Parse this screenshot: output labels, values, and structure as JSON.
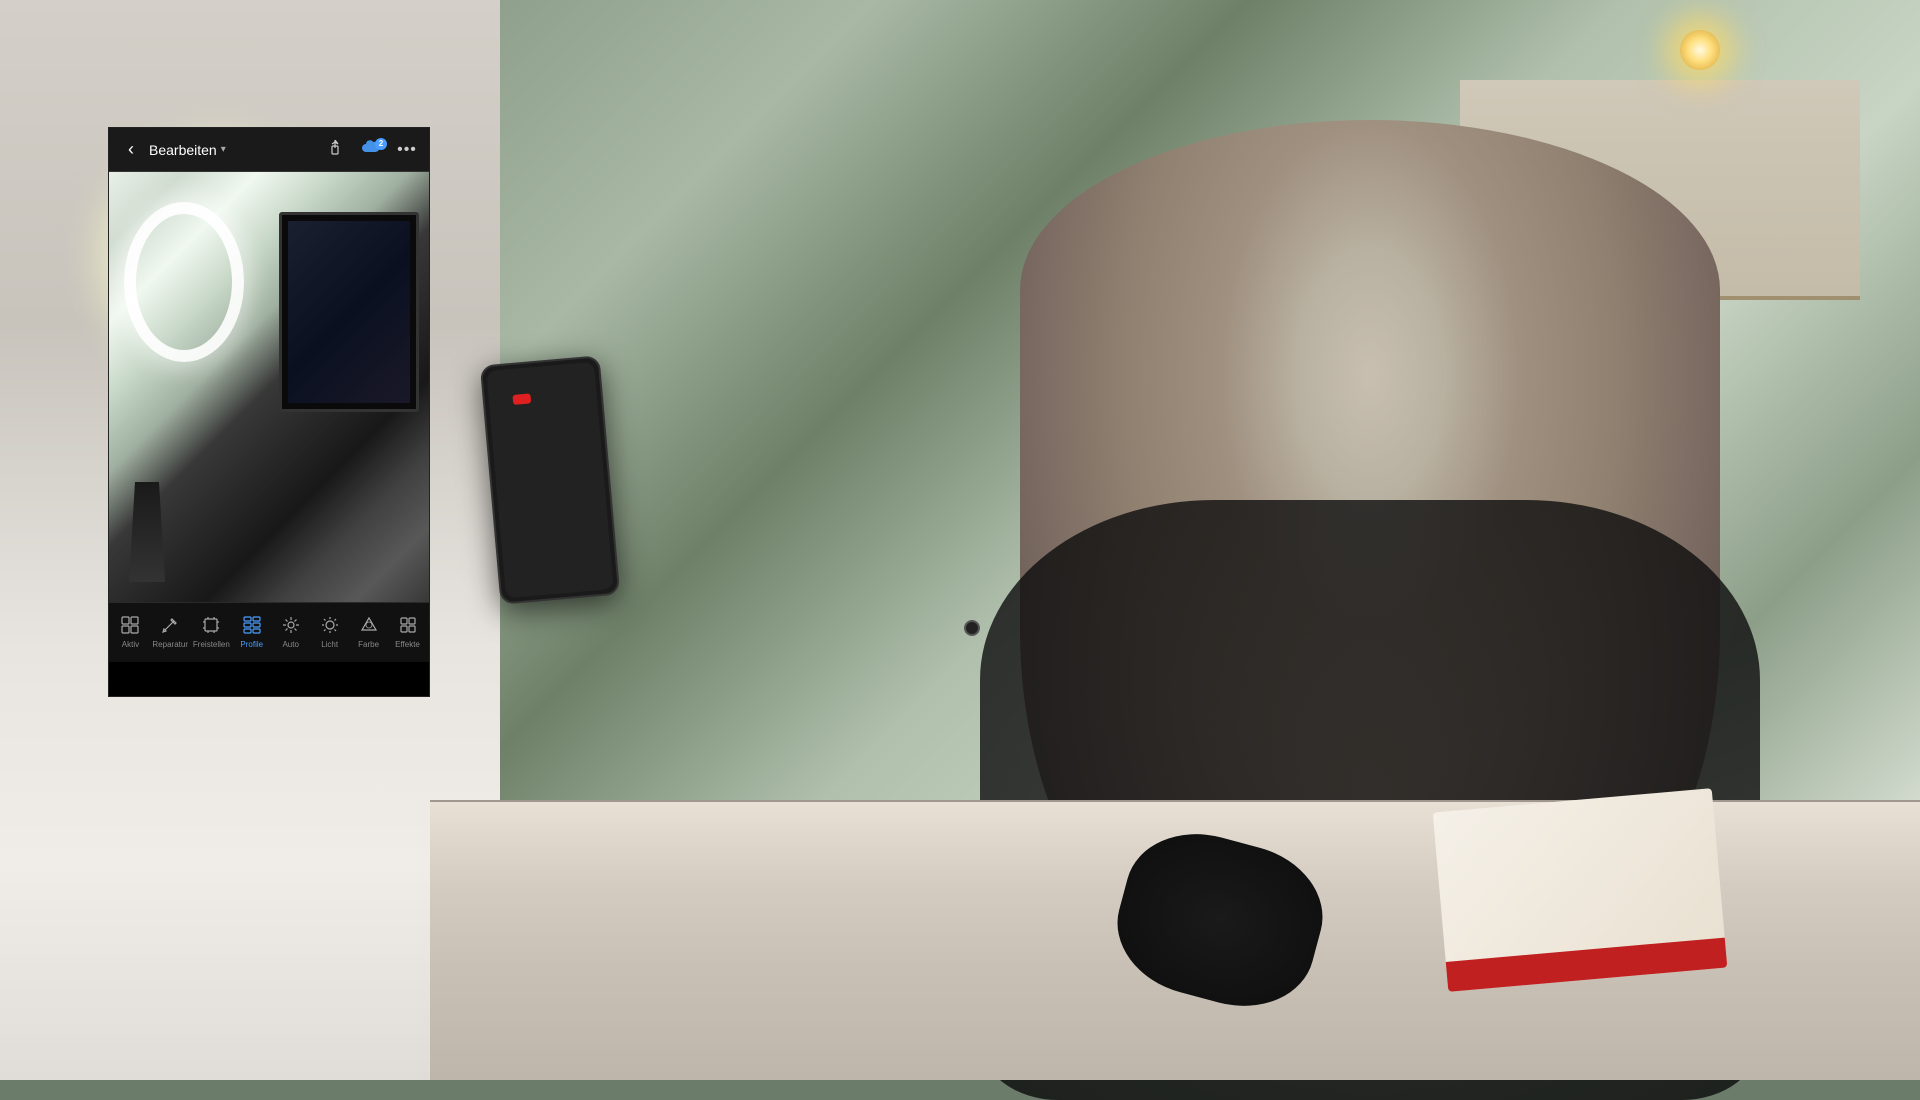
{
  "scene": {
    "description": "YouTube video frame showing person using Lightroom mobile app"
  },
  "lightroom": {
    "header": {
      "back_label": "‹",
      "title": "Bearbeiten",
      "chevron": "▾",
      "share_icon": "⬆",
      "cloud_count": "2",
      "more_icon": "···"
    },
    "toolbar": {
      "items": [
        {
          "id": "aktiv",
          "label": "Aktiv",
          "icon": "⊞",
          "active": false
        },
        {
          "id": "reparatur",
          "label": "Reparatur",
          "icon": "✎",
          "active": false
        },
        {
          "id": "freistellen",
          "label": "Freistellen",
          "icon": "⊡",
          "active": false
        },
        {
          "id": "profile",
          "label": "Profile",
          "icon": "▤",
          "active": true
        },
        {
          "id": "auto",
          "label": "Auto",
          "icon": "✦",
          "active": false
        },
        {
          "id": "licht",
          "label": "Licht",
          "icon": "☀",
          "active": false
        },
        {
          "id": "farbe",
          "label": "Farbe",
          "icon": "⬡",
          "active": false
        },
        {
          "id": "effekte",
          "label": "Effekte",
          "icon": "⊞",
          "active": false
        }
      ]
    }
  }
}
